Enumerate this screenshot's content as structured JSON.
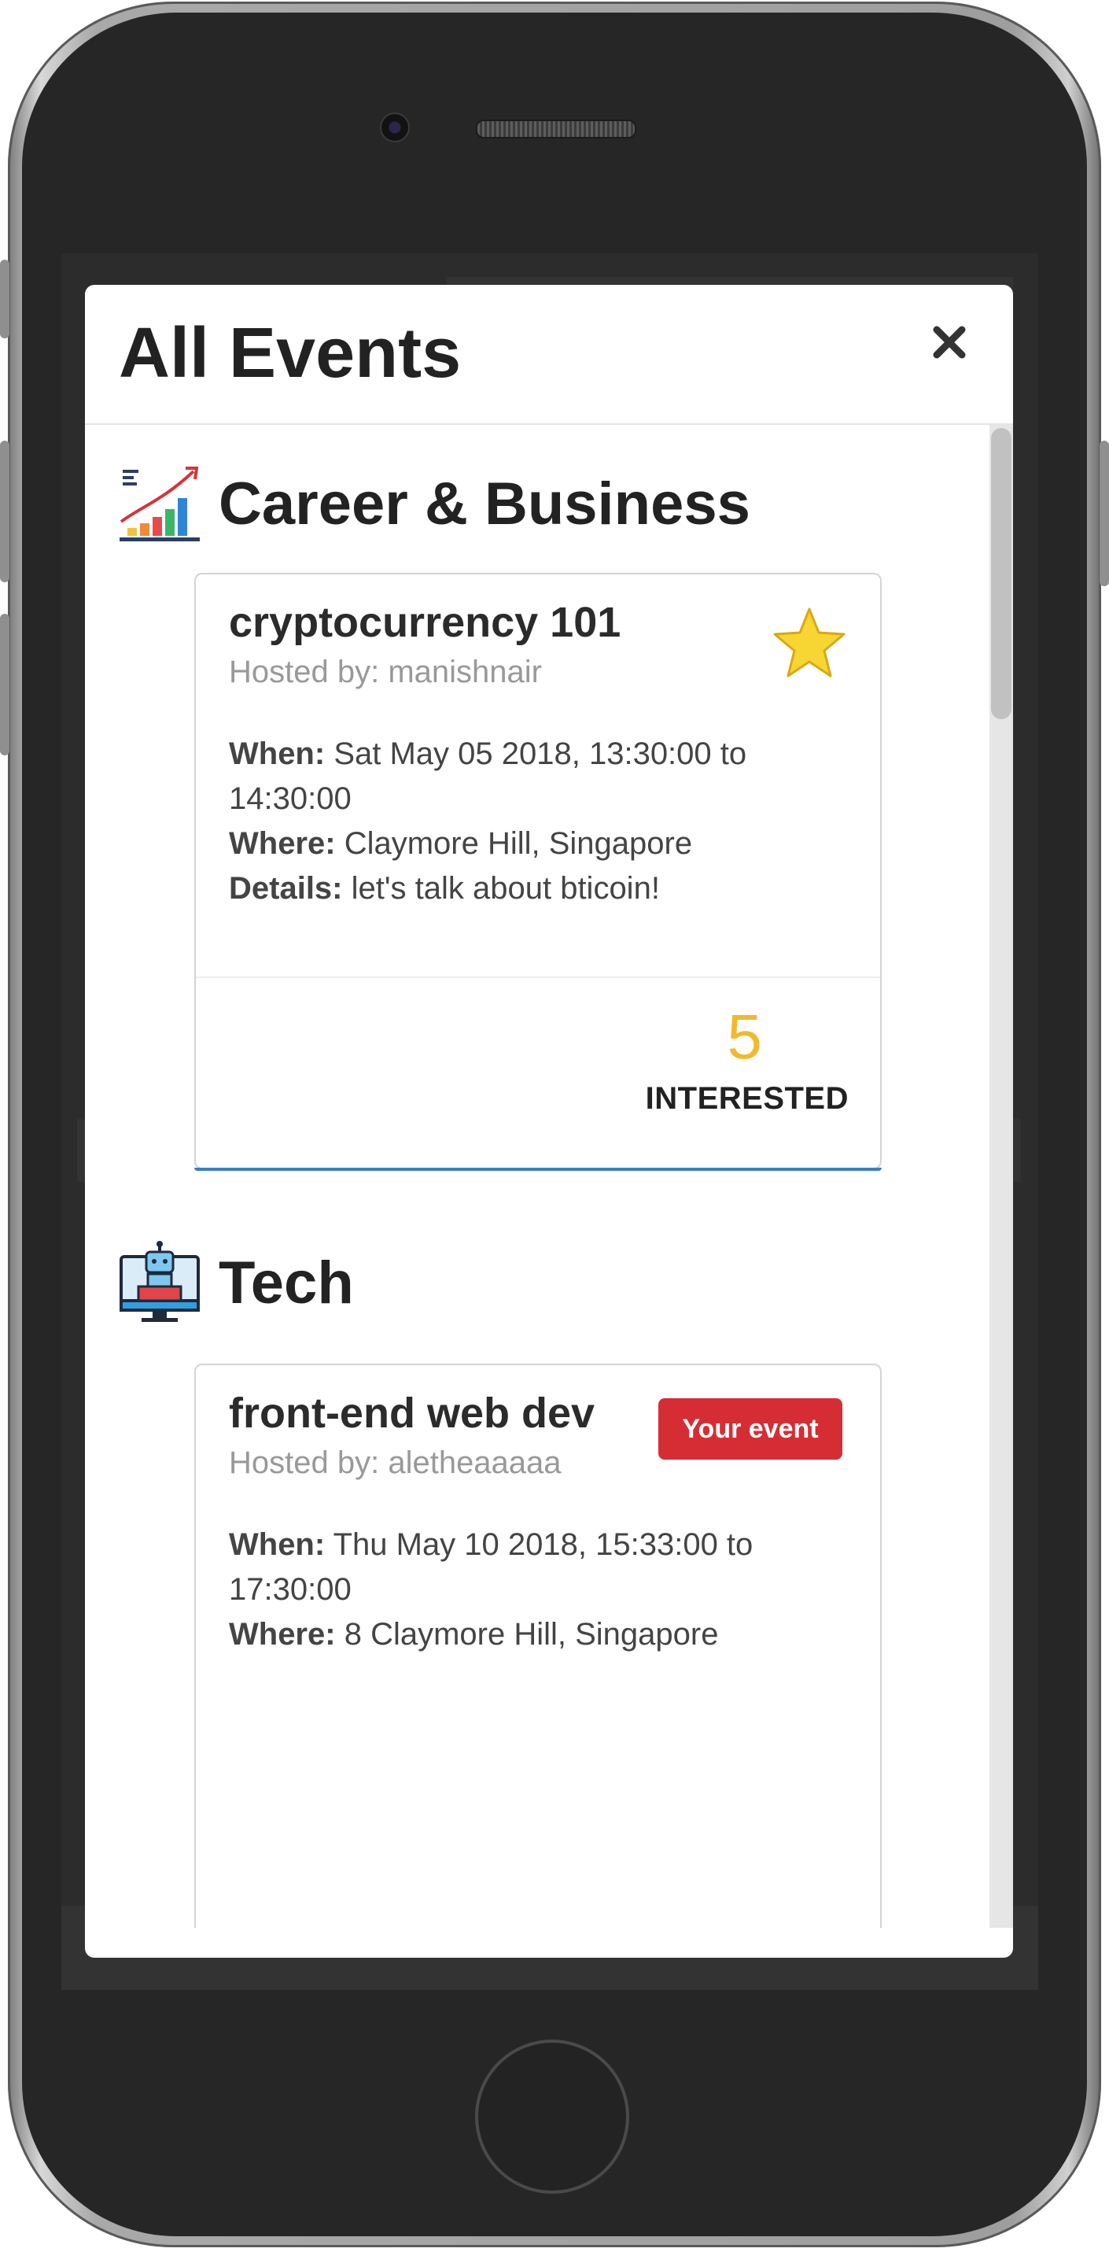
{
  "modal": {
    "title": "All Events",
    "close_label": "✖"
  },
  "categories": [
    {
      "name": "Career & Business",
      "icon": "chart-growth-icon",
      "events": [
        {
          "title": "cryptocurrency 101",
          "host_label": "Hosted by: manishnair",
          "when_label": "When:",
          "when": "Sat May 05 2018, 13:30:00 to 14:30:00",
          "where_label": "Where:",
          "where": "Claymore Hill, Singapore",
          "details_label": "Details:",
          "details": "let's talk about bticoin!",
          "starred": true,
          "interested_count": "5",
          "interested_label": "INTERESTED"
        }
      ]
    },
    {
      "name": "Tech",
      "icon": "robot-computer-icon",
      "events": [
        {
          "title": "front-end web dev",
          "host_label": "Hosted by: aletheaaaaa",
          "badge": "Your event",
          "when_label": "When:",
          "when": "Thu May 10 2018, 15:33:00 to 17:30:00",
          "where_label": "Where:",
          "where": "8 Claymore Hill, Singapore"
        }
      ]
    }
  ],
  "colors": {
    "accent_gold": "#f0b92e",
    "badge_red": "#d62d34",
    "card_accent_blue": "#3b7dc4"
  }
}
